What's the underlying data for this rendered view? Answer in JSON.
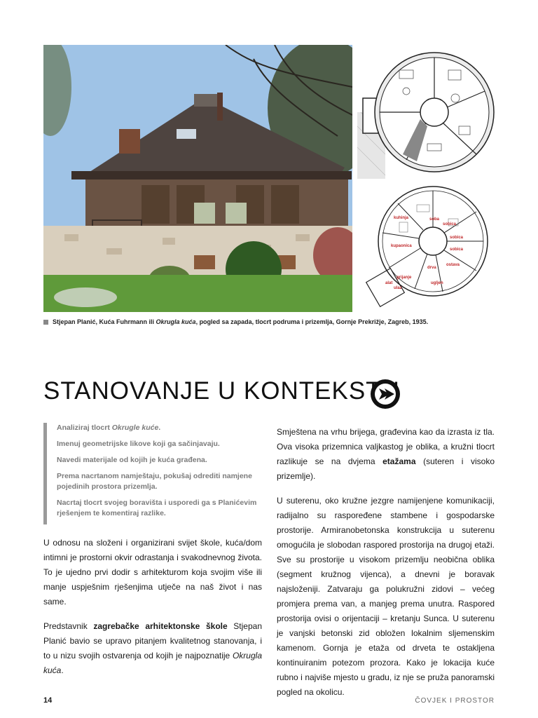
{
  "caption": {
    "part1": "Stjepan Planić, Kuća Fuhrmann ili ",
    "italic": "Okrugla kuća",
    "part2": ", pogled sa zapada, tlocrt podruma i prizemlja, Gornje Prekrižje, Zagreb, 1935."
  },
  "title": "STANOVANJE U KONTEKSTU",
  "plan_labels": [
    "kuhinja",
    "soba",
    "sobica",
    "sobica",
    "kupaonica",
    "sobica",
    "drva",
    "ostava",
    "grijanje",
    "ugljen",
    "alat",
    "ulaz"
  ],
  "tasks": {
    "t1_a": "Analiziraj tlocrt ",
    "t1_b": "Okrugle kuće",
    "t1_c": ".",
    "t2": "Imenuj geometrijske likove koji ga sačinjavaju.",
    "t3": "Navedi materijale od kojih je kuća građena.",
    "t4": "Prema nacrtanom namještaju, pokušaj odrediti namjene pojedinih prostora prizemlja.",
    "t5": "Nacrtaj tlocrt svojeg boravišta i usporedi ga s Planićevim rješenjem te komentiraj razlike."
  },
  "left_col": {
    "p1": "U odnosu na složeni i organizirani svijet škole, kuća/dom intimni je prostorni okvir odrastanja i svakodnevnog života. To je ujedno prvi dodir s arhitekturom koja svojim više ili manje uspješnim rješenjima utječe na naš život i nas same.",
    "p2_a": "Predstavnik ",
    "p2_b": "zagrebačke arhitektonske škole",
    "p2_c": " Stjepan Planić bavio se upravo pitanjem kvalitetnog stanovanja, i to u nizu svojih ostvarenja od kojih je najpoznatije ",
    "p2_d": "Okrugla kuća",
    "p2_e": "."
  },
  "right_col": {
    "p1_a": "Smještena na vrhu brijega, građevina kao da izrasta iz tla. Ova visoka prizemnica valjkastog je oblika, a kružni tlocrt razlikuje se na dvjema ",
    "p1_b": "etažama",
    "p1_c": " (suteren i visoko prizemlje).",
    "p2": "U suterenu, oko kružne jezgre namijenjene komunikaciji, radijalno su raspoređene stambene i gospodarske prostorije. Armiranobetonska konstrukcija u suterenu omogućila je slobodan raspored prostorija na drugoj etaži. Sve su prostorije u visokom prizemlju neobična oblika (segment kružnog vijenca), a dnevni je boravak najsloženiji. Zatvaraju ga polukružni zidovi – većeg promjera prema van, a manjeg prema unutra. Raspored prostorija ovisi o orijentaciji – kretanju Sunca. U suterenu je vanjski betonski zid obložen lokalnim sljemenskim kamenom. Gornja je etaža od drveta te ostakljena kontinuiranim potezom prozora. Kako je lokacija kuće rubno i najviše mjesto u gradu, iz nje se pruža panoramski pogled na okolicu."
  },
  "footer": {
    "page": "14",
    "section": "ČOVJEK I PROSTOR"
  }
}
